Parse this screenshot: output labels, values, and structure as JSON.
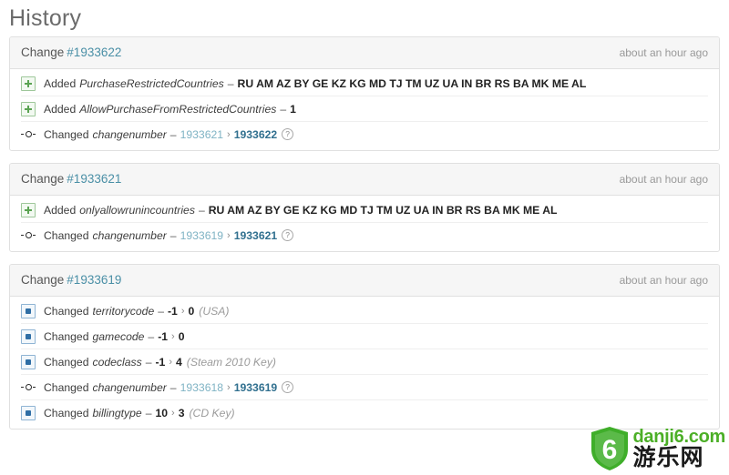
{
  "page": {
    "title": "History"
  },
  "icons": {
    "added": "plus-box-icon",
    "changed_field": "blue-dot-box-icon",
    "changed_commit": "commit-node-icon",
    "help": "?"
  },
  "cards": [
    {
      "label": "Change",
      "id": "#1933622",
      "time": "about an hour ago",
      "rows": [
        {
          "icon": "added",
          "verb": "Added",
          "field": "PurchaseRestrictedCountries",
          "dash": "–",
          "value": "RU AM AZ BY GE KZ KG MD TJ TM UZ UA IN BR RS BA MK ME AL",
          "type": "added"
        },
        {
          "icon": "added",
          "verb": "Added",
          "field": "AllowPurchaseFromRestrictedCountries",
          "dash": "–",
          "value": "1",
          "type": "added"
        },
        {
          "icon": "changed_commit",
          "verb": "Changed",
          "field": "changenumber",
          "dash": "–",
          "old": "1933621",
          "arrow": "›",
          "new": "1933622",
          "help": "?",
          "type": "changenumber"
        }
      ]
    },
    {
      "label": "Change",
      "id": "#1933621",
      "time": "about an hour ago",
      "rows": [
        {
          "icon": "added",
          "verb": "Added",
          "field": "onlyallowrunincountries",
          "dash": "–",
          "value": "RU AM AZ BY GE KZ KG MD TJ TM UZ UA IN BR RS BA MK ME AL",
          "type": "added"
        },
        {
          "icon": "changed_commit",
          "verb": "Changed",
          "field": "changenumber",
          "dash": "–",
          "old": "1933619",
          "arrow": "›",
          "new": "1933621",
          "help": "?",
          "type": "changenumber"
        }
      ]
    },
    {
      "label": "Change",
      "id": "#1933619",
      "time": "about an hour ago",
      "rows": [
        {
          "icon": "changed_field",
          "verb": "Changed",
          "field": "territorycode",
          "dash": "–",
          "old": "-1",
          "arrow": "›",
          "new": "0",
          "annotation": "(USA)",
          "type": "changed"
        },
        {
          "icon": "changed_field",
          "verb": "Changed",
          "field": "gamecode",
          "dash": "–",
          "old": "-1",
          "arrow": "›",
          "new": "0",
          "annotation": "",
          "type": "changed"
        },
        {
          "icon": "changed_field",
          "verb": "Changed",
          "field": "codeclass",
          "dash": "–",
          "old": "-1",
          "arrow": "›",
          "new": "4",
          "annotation": "(Steam 2010 Key)",
          "type": "changed"
        },
        {
          "icon": "changed_commit",
          "verb": "Changed",
          "field": "changenumber",
          "dash": "–",
          "old": "1933618",
          "arrow": "›",
          "new": "1933619",
          "help": "?",
          "type": "changenumber"
        },
        {
          "icon": "changed_field",
          "verb": "Changed",
          "field": "billingtype",
          "dash": "–",
          "old": "10",
          "arrow": "›",
          "new": "3",
          "annotation": "(CD Key)",
          "type": "changed"
        }
      ]
    }
  ],
  "watermark": {
    "shield_text": "6",
    "domain": "danji6.com",
    "cn": "游乐网"
  },
  "colors": {
    "link": "#4a8fa6",
    "added_icon": "#5aa352",
    "changed_icon": "#2f6ea5",
    "new_value": "#31708f",
    "old_value": "#7fb3c4",
    "watermark_green": "#4caf27"
  }
}
